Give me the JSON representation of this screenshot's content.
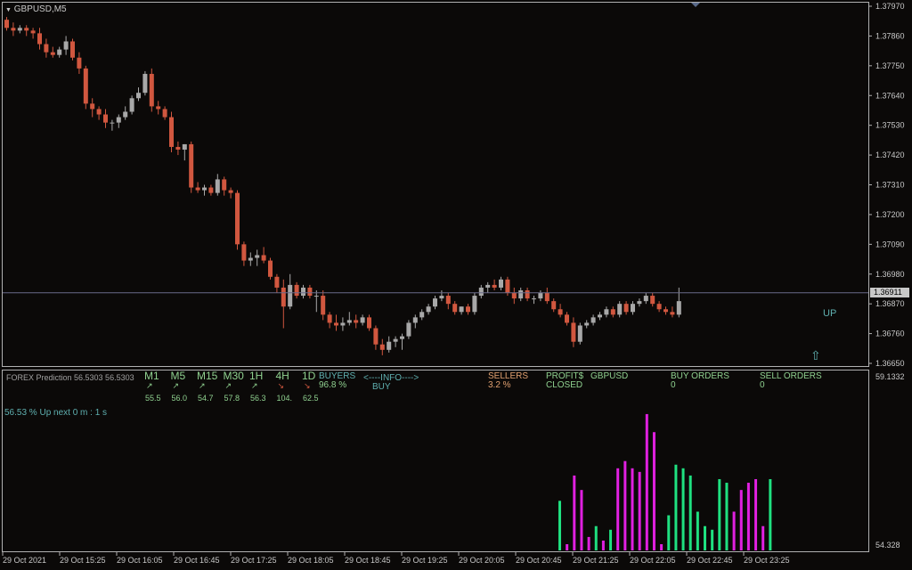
{
  "chart_title": "GBPUSD,M5",
  "price_axis": {
    "labels": [
      "1.37970",
      "1.37860",
      "1.37750",
      "1.37640",
      "1.37530",
      "1.37420",
      "1.37310",
      "1.37200",
      "1.37090",
      "1.36980",
      "1.36870",
      "1.36760",
      "1.36650"
    ],
    "current_price": "1.36911"
  },
  "indicator_axis": {
    "top": "59.1332",
    "bottom": "54.328"
  },
  "time_axis": [
    "29 Oct 2021",
    "29 Oct 15:25",
    "29 Oct 16:05",
    "29 Oct 16:45",
    "29 Oct 17:25",
    "29 Oct 18:05",
    "29 Oct 18:45",
    "29 Oct 19:25",
    "29 Oct 20:05",
    "29 Oct 20:45",
    "29 Oct 21:25",
    "29 Oct 22:05",
    "29 Oct 22:45",
    "29 Oct 23:25"
  ],
  "colors": {
    "bull": "#a8a8a8",
    "bear": "#d1573f",
    "buyers_bar": "#1fe080",
    "sellers_bar": "#e020e0",
    "label_green": "#8fd08f",
    "label_orange": "#e0a070",
    "label_cyan": "#5fb0b0",
    "bid_line": "#6a6a8a"
  },
  "annotations": {
    "up_label": "UP",
    "up_arrow": "⇧"
  },
  "panel": {
    "prediction_label": "FOREX Prediction 56.5303 56.5303",
    "timeframes": [
      {
        "label": "M1",
        "dir": "up",
        "value": "55.5"
      },
      {
        "label": "M5",
        "dir": "up",
        "value": "56.0"
      },
      {
        "label": "M15",
        "dir": "up",
        "value": "54.7"
      },
      {
        "label": "M30",
        "dir": "up",
        "value": "57.8"
      },
      {
        "label": "1H",
        "dir": "up",
        "value": "56.3"
      },
      {
        "label": "4H",
        "dir": "down",
        "value": "104."
      },
      {
        "label": "1D",
        "dir": "down",
        "value": "62.5"
      }
    ],
    "buyers_label": "BUYERS",
    "buyers_value": "96.8 %",
    "info_label": "<----INFO---->",
    "info_signal": "BUY",
    "sellers_label": "SELLERS",
    "sellers_value": "3.2 %",
    "profit_label": "PROFIT$",
    "profit_value": "CLOSED",
    "symbol": "GBPUSD",
    "buy_orders_label": "BUY ORDERS",
    "buy_orders_value": "0",
    "sell_orders_label": "SELL ORDERS",
    "sell_orders_value": "0",
    "status_line": "56.53 % Up next 0 m : 1 s"
  },
  "chart_data": {
    "type": "candlestick",
    "symbol": "GBPUSD",
    "timeframe": "M5",
    "ylim": [
      1.3665,
      1.3797
    ],
    "current_price": 1.36911,
    "candles": [
      [
        1.3792,
        1.3793,
        1.3788,
        1.3789
      ],
      [
        1.3789,
        1.3791,
        1.3786,
        1.3788
      ],
      [
        1.3788,
        1.379,
        1.3787,
        1.3789
      ],
      [
        1.3789,
        1.379,
        1.3786,
        1.3788
      ],
      [
        1.3788,
        1.3789,
        1.3785,
        1.3787
      ],
      [
        1.3787,
        1.3789,
        1.3781,
        1.3783
      ],
      [
        1.3783,
        1.3785,
        1.3778,
        1.378
      ],
      [
        1.378,
        1.3782,
        1.3778,
        1.3779
      ],
      [
        1.3779,
        1.3782,
        1.3778,
        1.3781
      ],
      [
        1.3781,
        1.3786,
        1.3779,
        1.3784
      ],
      [
        1.3784,
        1.3785,
        1.3777,
        1.3778
      ],
      [
        1.3778,
        1.378,
        1.3772,
        1.3774
      ],
      [
        1.3774,
        1.3775,
        1.3759,
        1.3761
      ],
      [
        1.3761,
        1.3763,
        1.3756,
        1.3759
      ],
      [
        1.3759,
        1.376,
        1.3755,
        1.3757
      ],
      [
        1.3757,
        1.3759,
        1.3752,
        1.3754
      ],
      [
        1.3754,
        1.3755,
        1.3751,
        1.3754
      ],
      [
        1.3754,
        1.3757,
        1.3752,
        1.3756
      ],
      [
        1.3756,
        1.376,
        1.3755,
        1.3758
      ],
      [
        1.3758,
        1.3764,
        1.3757,
        1.3763
      ],
      [
        1.3763,
        1.3767,
        1.3762,
        1.3765
      ],
      [
        1.3765,
        1.3773,
        1.3764,
        1.3772
      ],
      [
        1.3772,
        1.3774,
        1.3758,
        1.376
      ],
      [
        1.376,
        1.3762,
        1.3757,
        1.3759
      ],
      [
        1.3759,
        1.376,
        1.3755,
        1.3756
      ],
      [
        1.3756,
        1.3758,
        1.3743,
        1.3745
      ],
      [
        1.3745,
        1.3747,
        1.3742,
        1.3744
      ],
      [
        1.3744,
        1.3746,
        1.374,
        1.3746
      ],
      [
        1.3746,
        1.3747,
        1.3728,
        1.373
      ],
      [
        1.373,
        1.3732,
        1.3728,
        1.3729
      ],
      [
        1.3729,
        1.3731,
        1.3727,
        1.373
      ],
      [
        1.373,
        1.3731,
        1.3727,
        1.3728
      ],
      [
        1.3728,
        1.3735,
        1.3727,
        1.3733
      ],
      [
        1.3733,
        1.3734,
        1.3727,
        1.3729
      ],
      [
        1.3729,
        1.373,
        1.3726,
        1.3728
      ],
      [
        1.3728,
        1.3729,
        1.3707,
        1.3709
      ],
      [
        1.3709,
        1.371,
        1.3701,
        1.3703
      ],
      [
        1.3703,
        1.3706,
        1.3701,
        1.3704
      ],
      [
        1.3704,
        1.3707,
        1.3701,
        1.3705
      ],
      [
        1.3705,
        1.3708,
        1.3702,
        1.3703
      ],
      [
        1.3703,
        1.3704,
        1.3696,
        1.3697
      ],
      [
        1.3697,
        1.3698,
        1.3691,
        1.3693
      ],
      [
        1.3693,
        1.3696,
        1.3678,
        1.3686
      ],
      [
        1.3686,
        1.3698,
        1.3685,
        1.3694
      ],
      [
        1.3694,
        1.3695,
        1.3689,
        1.369
      ],
      [
        1.369,
        1.3694,
        1.3689,
        1.3693
      ],
      [
        1.3693,
        1.3694,
        1.3689,
        1.369
      ],
      [
        1.369,
        1.3692,
        1.3684,
        1.369
      ],
      [
        1.369,
        1.3692,
        1.3681,
        1.3683
      ],
      [
        1.3683,
        1.3684,
        1.3678,
        1.368
      ],
      [
        1.368,
        1.3683,
        1.3677,
        1.3679
      ],
      [
        1.3679,
        1.3682,
        1.3677,
        1.368
      ],
      [
        1.368,
        1.3684,
        1.3679,
        1.3681
      ],
      [
        1.3681,
        1.3683,
        1.3678,
        1.368
      ],
      [
        1.368,
        1.3683,
        1.3679,
        1.3682
      ],
      [
        1.3682,
        1.3683,
        1.3677,
        1.3678
      ],
      [
        1.3678,
        1.3679,
        1.367,
        1.3672
      ],
      [
        1.3672,
        1.3674,
        1.3668,
        1.367
      ],
      [
        1.367,
        1.3675,
        1.3669,
        1.3673
      ],
      [
        1.3673,
        1.3675,
        1.3671,
        1.3674
      ],
      [
        1.3674,
        1.3676,
        1.367,
        1.3675
      ],
      [
        1.3675,
        1.3681,
        1.3674,
        1.368
      ],
      [
        1.368,
        1.3683,
        1.3678,
        1.3682
      ],
      [
        1.3682,
        1.3685,
        1.3681,
        1.3684
      ],
      [
        1.3684,
        1.3687,
        1.3683,
        1.3686
      ],
      [
        1.3686,
        1.369,
        1.3685,
        1.3689
      ],
      [
        1.3689,
        1.3692,
        1.3688,
        1.369
      ],
      [
        1.369,
        1.3691,
        1.3685,
        1.3687
      ],
      [
        1.3687,
        1.3688,
        1.3683,
        1.3684
      ],
      [
        1.3684,
        1.3686,
        1.3683,
        1.3686
      ],
      [
        1.3686,
        1.3687,
        1.3683,
        1.3684
      ],
      [
        1.3684,
        1.3691,
        1.3683,
        1.369
      ],
      [
        1.369,
        1.3694,
        1.3689,
        1.3693
      ],
      [
        1.3693,
        1.3695,
        1.3691,
        1.3694
      ],
      [
        1.3694,
        1.3696,
        1.3692,
        1.3693
      ],
      [
        1.3693,
        1.3697,
        1.3692,
        1.3696
      ],
      [
        1.3696,
        1.3697,
        1.369,
        1.3691
      ],
      [
        1.3691,
        1.3693,
        1.3687,
        1.3689
      ],
      [
        1.3689,
        1.3693,
        1.3688,
        1.3692
      ],
      [
        1.3692,
        1.3693,
        1.3688,
        1.3689
      ],
      [
        1.3689,
        1.369,
        1.3687,
        1.3689
      ],
      [
        1.3689,
        1.3692,
        1.3688,
        1.3691
      ],
      [
        1.3691,
        1.3693,
        1.3687,
        1.3688
      ],
      [
        1.3688,
        1.3689,
        1.3684,
        1.3685
      ],
      [
        1.3685,
        1.3687,
        1.3682,
        1.3683
      ],
      [
        1.3683,
        1.3684,
        1.3679,
        1.368
      ],
      [
        1.368,
        1.3682,
        1.3671,
        1.3673
      ],
      [
        1.3673,
        1.368,
        1.3672,
        1.3679
      ],
      [
        1.3679,
        1.3681,
        1.3678,
        1.368
      ],
      [
        1.368,
        1.3683,
        1.3679,
        1.3682
      ],
      [
        1.3682,
        1.3684,
        1.3681,
        1.3683
      ],
      [
        1.3683,
        1.3686,
        1.3682,
        1.3685
      ],
      [
        1.3685,
        1.3686,
        1.3682,
        1.3683
      ],
      [
        1.3683,
        1.3688,
        1.3682,
        1.3687
      ],
      [
        1.3687,
        1.3688,
        1.3683,
        1.3684
      ],
      [
        1.3684,
        1.3688,
        1.3683,
        1.3687
      ],
      [
        1.3687,
        1.3689,
        1.3686,
        1.3688
      ],
      [
        1.3688,
        1.3691,
        1.3687,
        1.369
      ],
      [
        1.369,
        1.3691,
        1.3686,
        1.3687
      ],
      [
        1.3687,
        1.3688,
        1.3684,
        1.3685
      ],
      [
        1.3685,
        1.3686,
        1.3683,
        1.3684
      ],
      [
        1.3684,
        1.3686,
        1.3682,
        1.3683
      ],
      [
        1.3683,
        1.3693,
        1.3682,
        1.3688
      ]
    ],
    "indicator": {
      "name": "FOREX Prediction",
      "ylim": [
        54.328,
        59.1332
      ],
      "series": [
        {
          "name": "BUYERS",
          "color": "#1fe080"
        },
        {
          "name": "SELLERS",
          "color": "#e020e0"
        }
      ],
      "bars": [
        {
          "value": 55.7,
          "side": "buy"
        },
        {
          "value": 54.5,
          "side": "sell"
        },
        {
          "value": 56.4,
          "side": "sell"
        },
        {
          "value": 56.0,
          "side": "sell"
        },
        {
          "value": 54.7,
          "side": "sell"
        },
        {
          "value": 55.0,
          "side": "buy"
        },
        {
          "value": 54.6,
          "side": "sell"
        },
        {
          "value": 54.9,
          "side": "buy"
        },
        {
          "value": 56.6,
          "side": "sell"
        },
        {
          "value": 56.8,
          "side": "sell"
        },
        {
          "value": 56.6,
          "side": "sell"
        },
        {
          "value": 56.5,
          "side": "sell"
        },
        {
          "value": 58.1,
          "side": "sell"
        },
        {
          "value": 57.6,
          "side": "sell"
        },
        {
          "value": 54.5,
          "side": "sell"
        },
        {
          "value": 55.3,
          "side": "buy"
        },
        {
          "value": 56.7,
          "side": "buy"
        },
        {
          "value": 56.6,
          "side": "buy"
        },
        {
          "value": 56.4,
          "side": "buy"
        },
        {
          "value": 55.4,
          "side": "buy"
        },
        {
          "value": 55.0,
          "side": "buy"
        },
        {
          "value": 54.9,
          "side": "buy"
        },
        {
          "value": 56.3,
          "side": "buy"
        },
        {
          "value": 56.2,
          "side": "buy"
        },
        {
          "value": 55.4,
          "side": "sell"
        },
        {
          "value": 56.0,
          "side": "sell"
        },
        {
          "value": 56.2,
          "side": "sell"
        },
        {
          "value": 56.3,
          "side": "sell"
        },
        {
          "value": 55.0,
          "side": "sell"
        },
        {
          "value": 56.3,
          "side": "buy"
        }
      ]
    }
  }
}
